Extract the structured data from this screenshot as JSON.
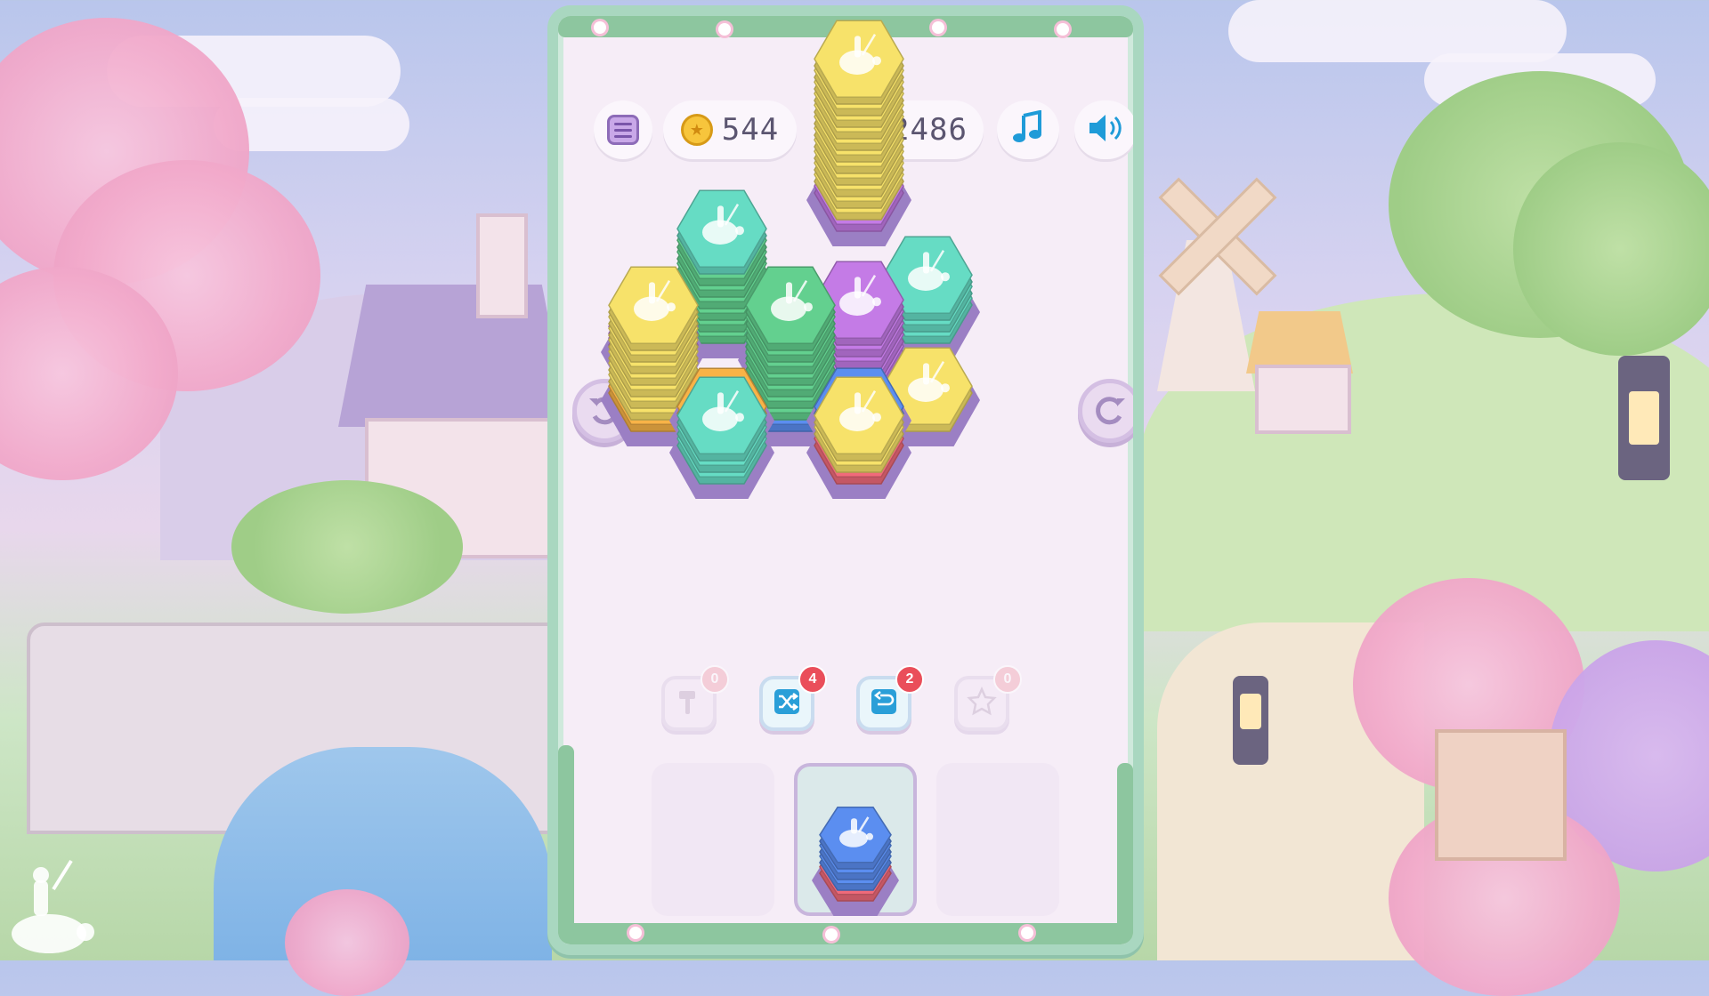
{
  "hud": {
    "coins": "544",
    "trophies": "2486"
  },
  "icons": {
    "menu": "menu-icon",
    "coin": "coin-icon",
    "trophy": "trophy-icon",
    "music": "music-note-icon",
    "sound": "speaker-icon",
    "rotate_left": "rotate-left-icon",
    "rotate_right": "rotate-right-icon",
    "hammer": "hammer-icon",
    "shuffle": "shuffle-icon",
    "undo": "undo-icon",
    "star": "star-icon"
  },
  "tools": [
    {
      "name": "hammer",
      "count": "0"
    },
    {
      "name": "shuffle",
      "count": "4"
    },
    {
      "name": "undo",
      "count": "2"
    },
    {
      "name": "star",
      "count": "0"
    }
  ],
  "colors": {
    "yellow": "#f7e26a",
    "green": "#63d08f",
    "teal": "#66dcc4",
    "purple": "#c47be6",
    "blue": "#5b8ef0",
    "orange": "#f8b347",
    "red": "#f06a7a",
    "panel_border": "#a9d7c0",
    "accent_red": "#ea4e5a"
  },
  "board": {
    "stacks": [
      {
        "col": 2,
        "row": 0.0,
        "layers": [
          "green",
          "green",
          "green",
          "green",
          "green",
          "green",
          "teal"
        ]
      },
      {
        "col": 4,
        "row": -1.4,
        "layers": [
          "purple",
          "yellow",
          "yellow",
          "yellow",
          "yellow",
          "yellow",
          "yellow",
          "yellow",
          "yellow",
          "yellow",
          "yellow",
          "yellow"
        ]
      },
      {
        "col": 5,
        "row": 0.0,
        "layers": [
          "teal",
          "teal",
          "teal"
        ]
      },
      {
        "col": 1,
        "row": 0.5,
        "layers": [
          "purple",
          "purple"
        ]
      },
      {
        "col": 3,
        "row": 0.6,
        "layers": [
          "teal",
          "teal"
        ]
      },
      {
        "col": 4,
        "row": 0.6,
        "layers": [
          "purple",
          "purple",
          "purple",
          "purple",
          "purple"
        ]
      },
      {
        "col": 1,
        "row": 1.1,
        "layers": [
          "orange",
          "yellow",
          "yellow",
          "yellow",
          "yellow",
          "yellow",
          "yellow",
          "yellow"
        ]
      },
      {
        "col": 3,
        "row": 1.1,
        "layers": [
          "blue",
          "green",
          "green",
          "green",
          "green",
          "green",
          "green",
          "green"
        ]
      },
      {
        "col": 2,
        "row": 1.35,
        "layers": [
          "orange"
        ]
      },
      {
        "col": 4,
        "row": 1.35,
        "layers": [
          "blue"
        ]
      },
      {
        "col": 5,
        "row": 1.1,
        "layers": [
          "yellow"
        ]
      },
      {
        "col": 2,
        "row": 1.75,
        "layers": [
          "teal",
          "teal",
          "teal"
        ]
      },
      {
        "col": 4,
        "row": 1.75,
        "layers": [
          "red",
          "yellow",
          "yellow"
        ]
      }
    ]
  },
  "tray": {
    "selected_slot": 1,
    "slots": [
      {
        "layers": []
      },
      {
        "layers": [
          "red",
          "blue",
          "blue",
          "blue"
        ]
      },
      {
        "layers": []
      }
    ]
  }
}
